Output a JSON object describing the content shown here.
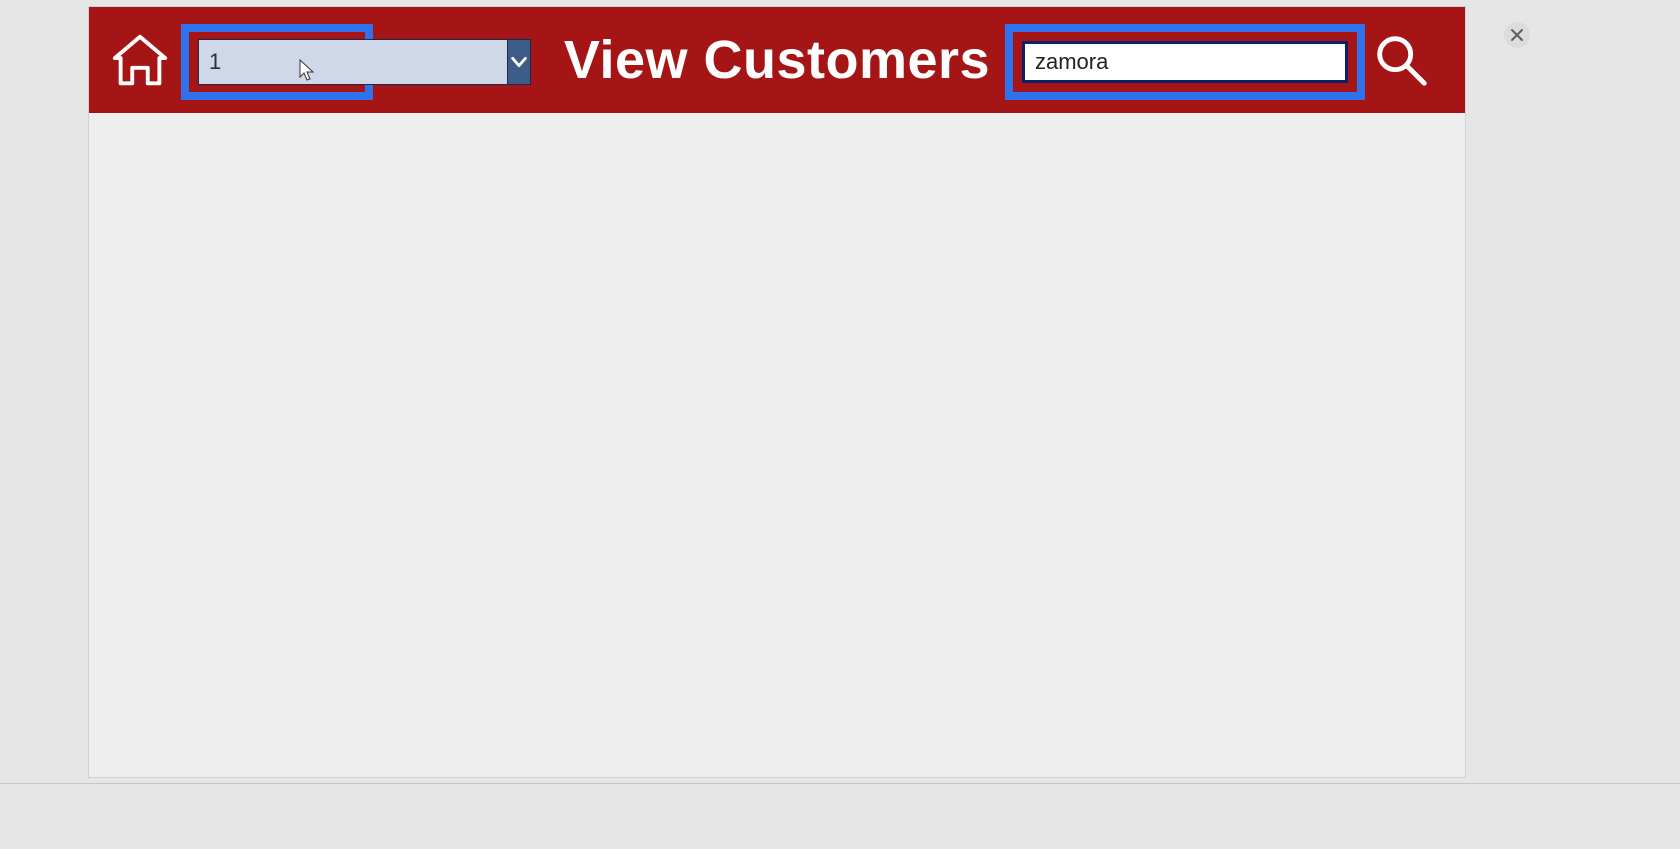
{
  "header": {
    "title": "View Customers",
    "dropdown": {
      "value": "1"
    },
    "search": {
      "value": "zamora"
    }
  }
}
